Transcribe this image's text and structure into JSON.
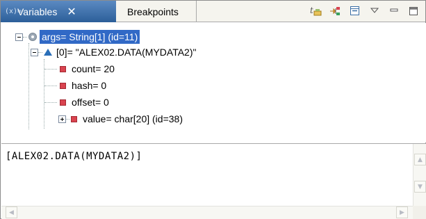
{
  "tabs": {
    "active_label": "Variables",
    "inactive_label": "Breakpoints"
  },
  "toolbar": {
    "icons": [
      "show-type-names-icon",
      "show-logical-structure-icon",
      "collapse-all-icon",
      "view-menu-icon",
      "minimize-icon",
      "maximize-icon"
    ]
  },
  "tree": {
    "rows": [
      {
        "label": "args= String[1]  (id=11)",
        "icon": "local-variable-icon",
        "expanded": true,
        "selected": true
      },
      {
        "label": "[0]= \"ALEX02.DATA(MYDATA2)\"",
        "icon": "array-element-icon",
        "expanded": true
      },
      {
        "label": "count= 20",
        "icon": "private-field-icon"
      },
      {
        "label": "hash= 0",
        "icon": "private-field-icon"
      },
      {
        "label": "offset= 0",
        "icon": "private-field-icon"
      },
      {
        "label": "value= char[20]  (id=38)",
        "icon": "private-field-icon",
        "expanded": false
      }
    ]
  },
  "detail": {
    "text": "[ALEX02.DATA(MYDATA2)]"
  },
  "colors": {
    "active_tab": "#3a6ea5",
    "selection": "#3169c6",
    "field_icon": "#d9434f",
    "array_icon": "#2a6fb8"
  }
}
